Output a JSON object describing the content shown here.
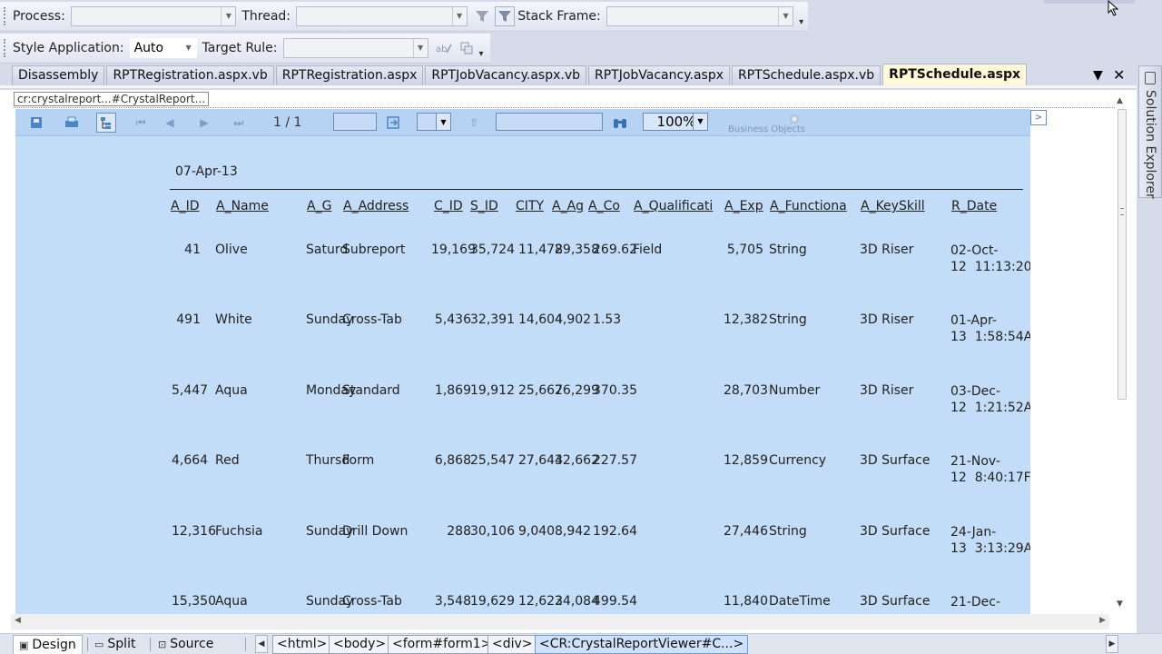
{
  "toolbar_debug": {
    "process_label": "Process:",
    "process_value": "",
    "thread_label": "Thread:",
    "thread_value": "",
    "stack_frame_label": "Stack Frame:",
    "stack_frame_value": ""
  },
  "toolbar_style": {
    "style_application_label": "Style Application:",
    "style_application_value": "Auto",
    "target_rule_label": "Target Rule:",
    "target_rule_value": ""
  },
  "tabs": [
    {
      "label": "Disassembly",
      "active": false
    },
    {
      "label": "RPTRegistration.aspx.vb",
      "active": false
    },
    {
      "label": "RPTRegistration.aspx",
      "active": false
    },
    {
      "label": "RPTJobVacancy.aspx.vb",
      "active": false
    },
    {
      "label": "RPTJobVacancy.aspx",
      "active": false
    },
    {
      "label": "RPTSchedule.aspx.vb",
      "active": false
    },
    {
      "label": "RPTSchedule.aspx",
      "active": true
    }
  ],
  "side_panel": {
    "label": "Solution Explorer"
  },
  "breadcrumb_tag": "cr:crystalreport...#CrystalReport...",
  "viewer": {
    "page_indicator": "1 / 1",
    "zoom": "100%",
    "logo_text": "Business Objects"
  },
  "report": {
    "date": "07-Apr-13",
    "headers": [
      "A_ID",
      "A_Name",
      "A_G",
      "A_Address",
      "C_ID",
      "S_ID",
      "CITY",
      "A_Ag",
      "A_Co",
      "A_Qualificati",
      "A_Exp",
      "A_Functiona",
      "A_KeySkill",
      "R_Date"
    ],
    "rows": [
      {
        "a_id": "41",
        "a_name": "Olive",
        "a_g": "Saturd",
        "a_address": "Subreport",
        "c_id": "19,169",
        "s_id": "35,724",
        "city": "11,478",
        "a_ag": "29,358",
        "a_co": "269.62",
        "a_qual": "Field",
        "a_exp": "5,705",
        "a_func": "String",
        "a_skill": "3D Riser",
        "r_date": "02-Oct-\n12  11:13:20"
      },
      {
        "a_id": "491",
        "a_name": "White",
        "a_g": "Sunday",
        "a_address": "Cross-Tab",
        "c_id": "5,436",
        "s_id": "32,391",
        "city": "14,604",
        "a_ag": "4,902",
        "a_co": "1.53",
        "a_qual": "",
        "a_exp": "12,382",
        "a_func": "String",
        "a_skill": "3D Riser",
        "r_date": "01-Apr-\n13  1:58:54A"
      },
      {
        "a_id": "5,447",
        "a_name": "Aqua",
        "a_g": "Monday",
        "a_address": "Standard",
        "c_id": "1,869",
        "s_id": "19,912",
        "city": "25,667",
        "a_ag": "26,299",
        "a_co": "370.35",
        "a_qual": "",
        "a_exp": "28,703",
        "a_func": "Number",
        "a_skill": "3D Riser",
        "r_date": "03-Dec-\n12  1:21:52A"
      },
      {
        "a_id": "4,664",
        "a_name": "Red",
        "a_g": "Thursd",
        "a_address": "Form",
        "c_id": "6,868",
        "s_id": "25,547",
        "city": "27,644",
        "a_ag": "32,662",
        "a_co": "227.57",
        "a_qual": "",
        "a_exp": "12,859",
        "a_func": "Currency",
        "a_skill": "3D Surface",
        "r_date": "21-Nov-\n12  8:40:17F"
      },
      {
        "a_id": "12,316",
        "a_name": "Fuchsia",
        "a_g": "Sunday",
        "a_address": "Drill Down",
        "c_id": "288",
        "s_id": "30,106",
        "city": "9,040",
        "a_ag": "8,942",
        "a_co": "192.64",
        "a_qual": "",
        "a_exp": "27,446",
        "a_func": "String",
        "a_skill": "3D Surface",
        "r_date": "24-Jan-\n13  3:13:29A"
      },
      {
        "a_id": "15,350",
        "a_name": "Aqua",
        "a_g": "Sunday",
        "a_address": "Cross-Tab",
        "c_id": "3,548",
        "s_id": "19,629",
        "city": "12,623",
        "a_ag": "24,084",
        "a_co": "499.54",
        "a_qual": "",
        "a_exp": "11,840",
        "a_func": "DateTime",
        "a_skill": "3D Surface",
        "r_date": "21-Dec-"
      }
    ]
  },
  "bottom_bar": {
    "views": [
      "Design",
      "Split",
      "Source"
    ],
    "tags": [
      "<html>",
      "<body>",
      "<form#form1>",
      "<div>",
      "<CR:CrystalReportViewer#C...>"
    ]
  }
}
